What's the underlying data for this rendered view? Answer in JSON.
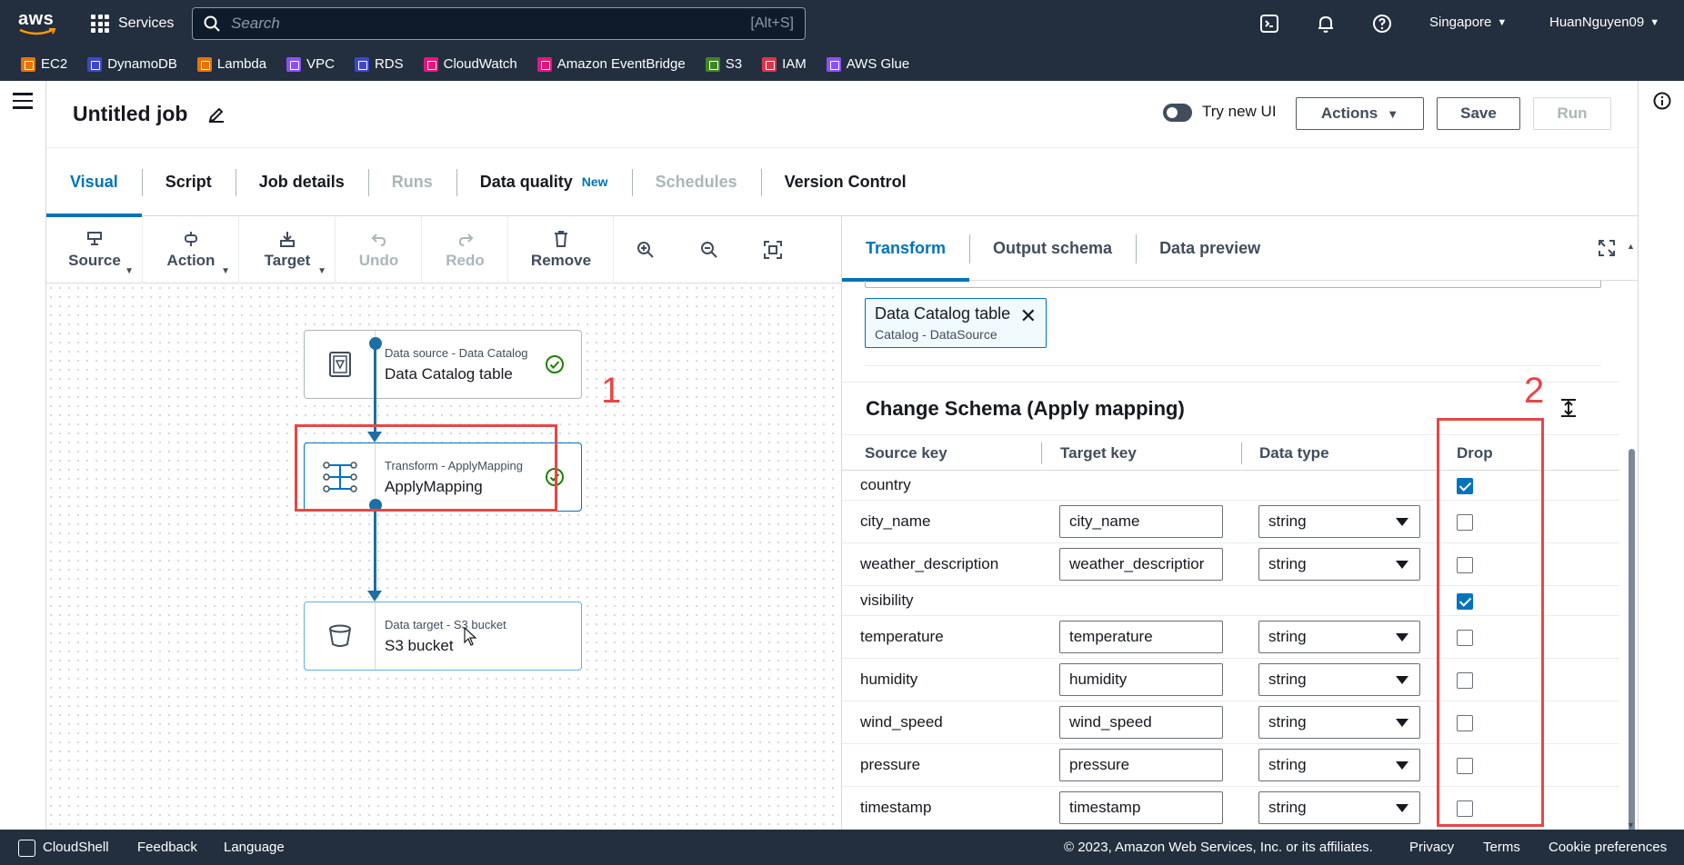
{
  "topbar": {
    "logo_text": "aws",
    "services_label": "Services",
    "search_placeholder": "Search",
    "search_shortcut": "[Alt+S]",
    "region": "Singapore",
    "user": "HuanNguyen09"
  },
  "favorites": [
    {
      "label": "EC2",
      "color": "#ed7100"
    },
    {
      "label": "DynamoDB",
      "color": "#3b48cc"
    },
    {
      "label": "Lambda",
      "color": "#ed7100"
    },
    {
      "label": "VPC",
      "color": "#8c4fff"
    },
    {
      "label": "RDS",
      "color": "#3b48cc"
    },
    {
      "label": "CloudWatch",
      "color": "#e7157b"
    },
    {
      "label": "Amazon EventBridge",
      "color": "#e7157b"
    },
    {
      "label": "S3",
      "color": "#3f8624"
    },
    {
      "label": "IAM",
      "color": "#dd344c"
    },
    {
      "label": "AWS Glue",
      "color": "#8c4fff"
    }
  ],
  "job": {
    "title": "Untitled job",
    "try_new_ui": "Try new UI",
    "actions_label": "Actions",
    "save_label": "Save",
    "run_label": "Run"
  },
  "tabs": [
    {
      "label": "Visual"
    },
    {
      "label": "Script"
    },
    {
      "label": "Job details"
    },
    {
      "label": "Runs"
    },
    {
      "label": "Data quality",
      "badge": "New"
    },
    {
      "label": "Schedules"
    },
    {
      "label": "Version Control"
    }
  ],
  "toolbar": {
    "source": "Source",
    "action": "Action",
    "target": "Target",
    "undo": "Undo",
    "redo": "Redo",
    "remove": "Remove"
  },
  "nodes": {
    "source": {
      "sub": "Data source - Data Catalog",
      "main": "Data Catalog table"
    },
    "transform": {
      "sub": "Transform - ApplyMapping",
      "main": "ApplyMapping"
    },
    "target": {
      "sub": "Data target - S3 bucket",
      "main": "S3 bucket"
    }
  },
  "annotations": {
    "one": "1",
    "two": "2"
  },
  "panel": {
    "tabs": [
      "Transform",
      "Output schema",
      "Data preview"
    ],
    "token_title": "Data Catalog table",
    "token_sub": "Catalog - DataSource",
    "section_title": "Change Schema (Apply mapping)",
    "headers": {
      "source": "Source key",
      "target": "Target key",
      "type": "Data type",
      "drop": "Drop"
    },
    "rows": [
      {
        "source": "country",
        "target": "",
        "type": "",
        "drop": true
      },
      {
        "source": "city_name",
        "target": "city_name",
        "type": "string",
        "drop": false
      },
      {
        "source": "weather_description",
        "target": "weather_descriptior",
        "type": "string",
        "drop": false
      },
      {
        "source": "visibility",
        "target": "",
        "type": "",
        "drop": true
      },
      {
        "source": "temperature",
        "target": "temperature",
        "type": "string",
        "drop": false
      },
      {
        "source": "humidity",
        "target": "humidity",
        "type": "string",
        "drop": false
      },
      {
        "source": "wind_speed",
        "target": "wind_speed",
        "type": "string",
        "drop": false
      },
      {
        "source": "pressure",
        "target": "pressure",
        "type": "string",
        "drop": false
      },
      {
        "source": "timestamp",
        "target": "timestamp",
        "type": "string",
        "drop": false
      }
    ]
  },
  "footer": {
    "cloudshell": "CloudShell",
    "feedback": "Feedback",
    "language": "Language",
    "copyright": "© 2023, Amazon Web Services, Inc. or its affiliates.",
    "privacy": "Privacy",
    "terms": "Terms",
    "cookies": "Cookie preferences"
  }
}
